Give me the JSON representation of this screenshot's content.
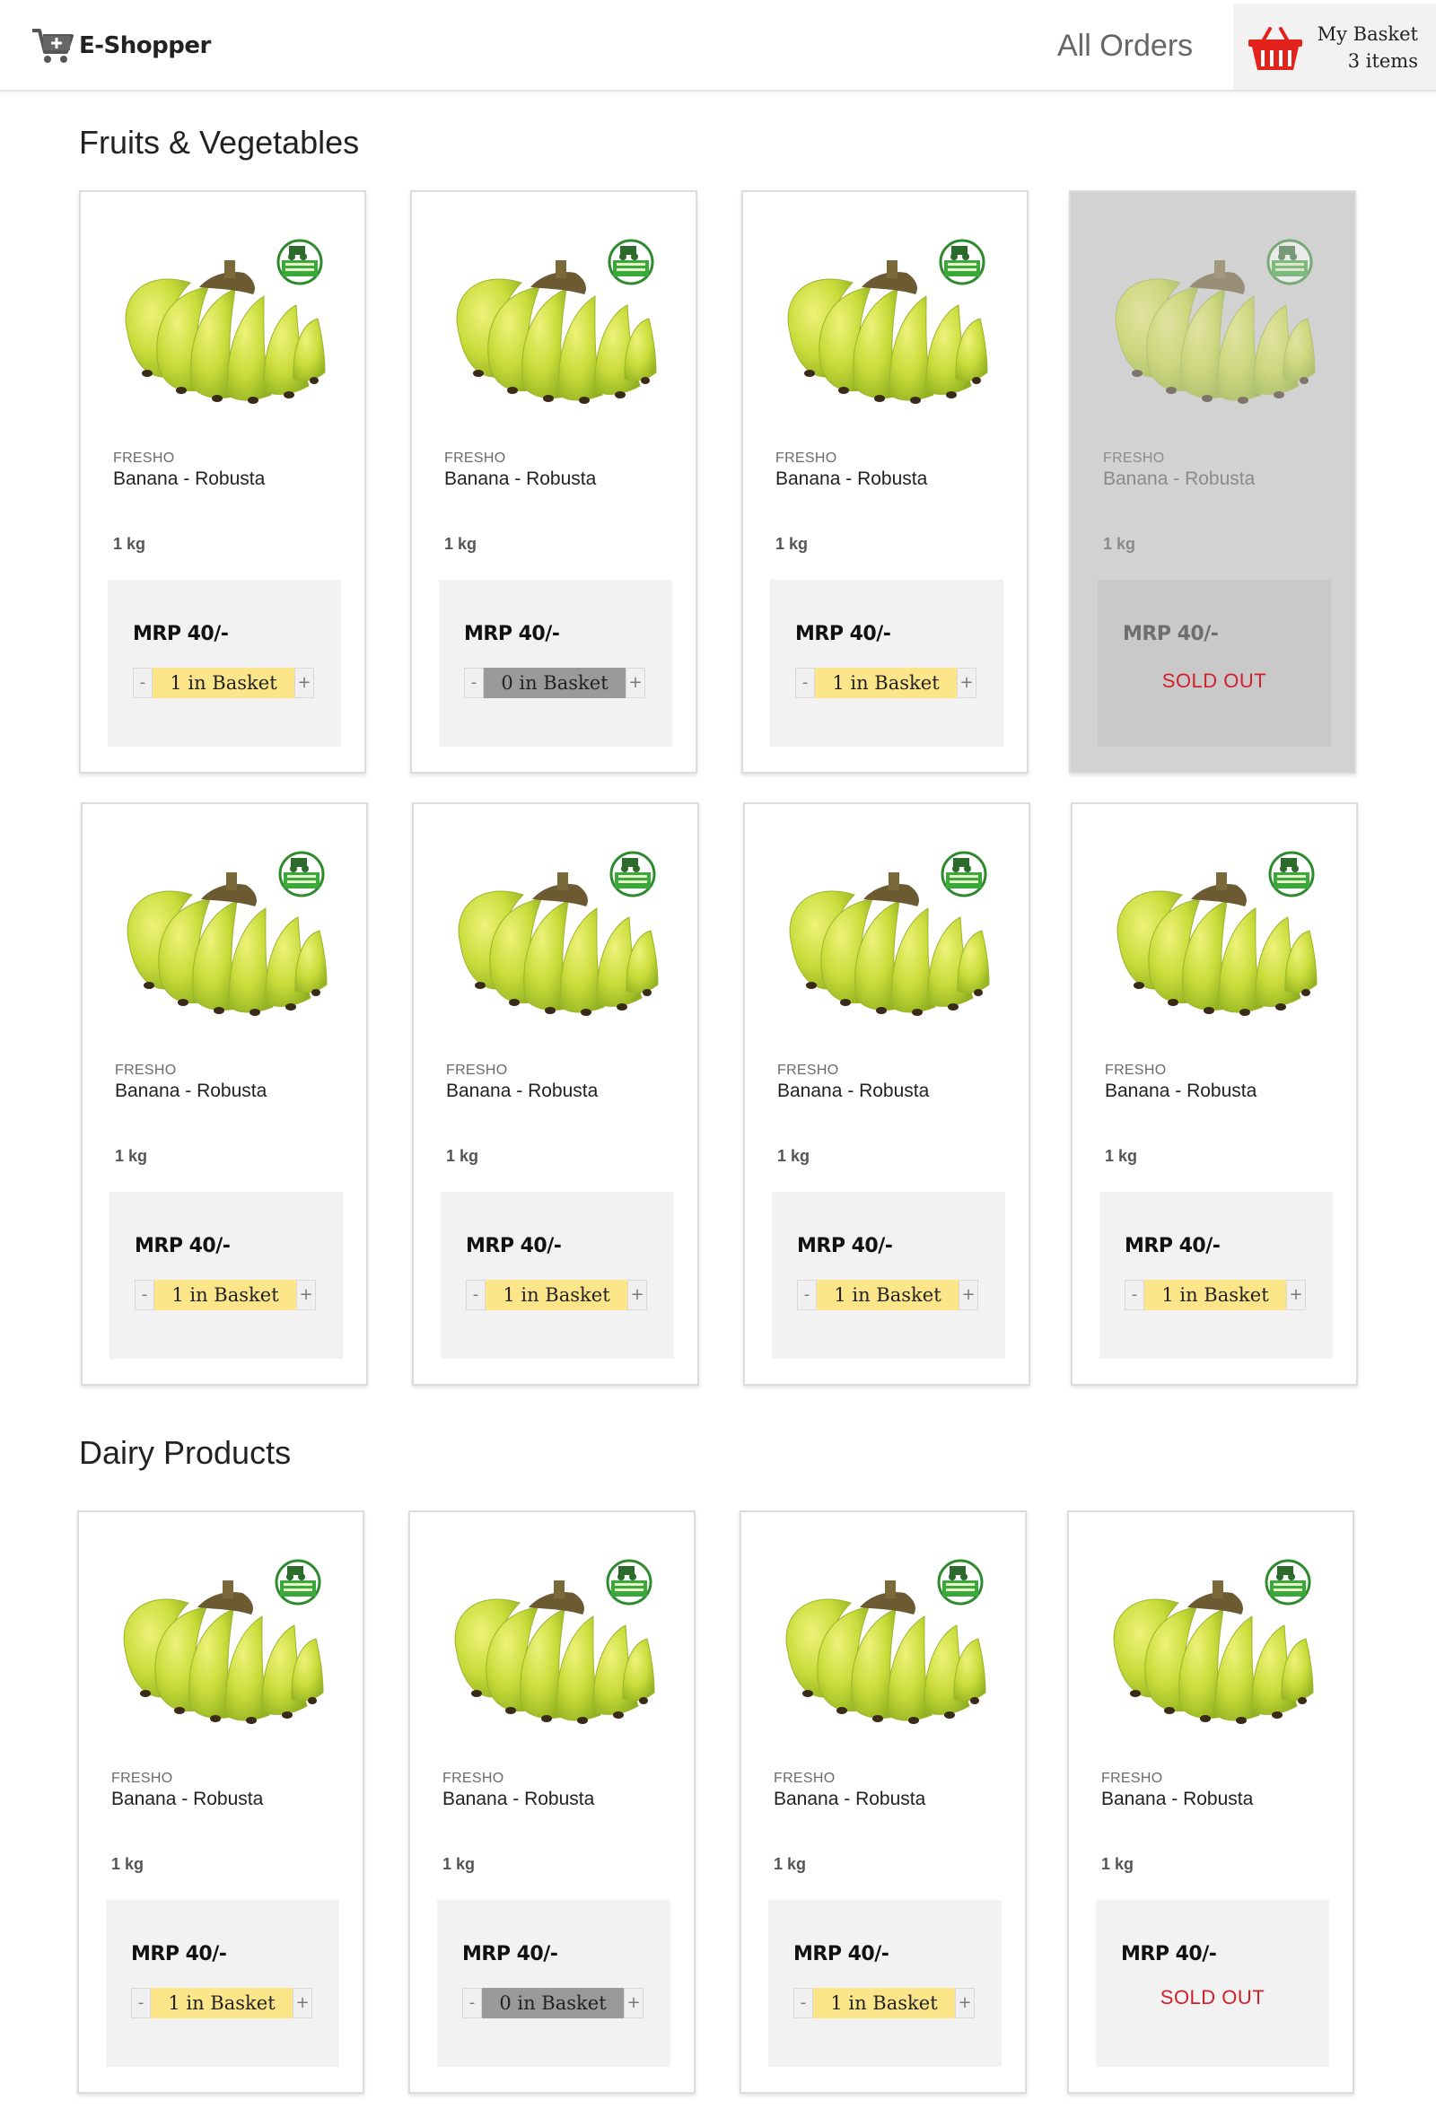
{
  "header": {
    "brand": "E-Shopper",
    "all_orders": "All Orders",
    "basket_title": "My Basket",
    "basket_count": "3 items"
  },
  "colors": {
    "basket_red": "#e3231b",
    "in_basket_yellow": "#fde68a",
    "zero_basket_gray": "#9a9a9a",
    "sold_out_red": "#d1202c"
  },
  "sections": [
    {
      "title": "Fruits & Vegetables",
      "products": [
        {
          "brand": "FRESHO",
          "name": "Banana - Robusta",
          "size": "1 kg",
          "price": "MRP 40/-",
          "basket": "1 in Basket",
          "minus": "-",
          "plus": "+"
        },
        {
          "brand": "FRESHO",
          "name": "Banana - Robusta",
          "size": "1 kg",
          "price": "MRP 40/-",
          "basket": "0 in Basket",
          "minus": "-",
          "plus": "+"
        },
        {
          "brand": "FRESHO",
          "name": "Banana - Robusta",
          "size": "1 kg",
          "price": "MRP 40/-",
          "basket": "1 in Basket",
          "minus": "-",
          "plus": "+"
        },
        {
          "brand": "FRESHO",
          "name": "Banana - Robusta",
          "size": "1 kg",
          "price": "MRP 40/-",
          "status": "SOLD OUT"
        },
        {
          "brand": "FRESHO",
          "name": "Banana - Robusta",
          "size": "1 kg",
          "price": "MRP 40/-",
          "basket": "1 in Basket",
          "minus": "-",
          "plus": "+"
        },
        {
          "brand": "FRESHO",
          "name": "Banana - Robusta",
          "size": "1 kg",
          "price": "MRP 40/-",
          "basket": "1 in Basket",
          "minus": "-",
          "plus": "+"
        },
        {
          "brand": "FRESHO",
          "name": "Banana - Robusta",
          "size": "1 kg",
          "price": "MRP 40/-",
          "basket": "1 in Basket",
          "minus": "-",
          "plus": "+"
        },
        {
          "brand": "FRESHO",
          "name": "Banana - Robusta",
          "size": "1 kg",
          "price": "MRP 40/-",
          "basket": "1 in Basket",
          "minus": "-",
          "plus": "+"
        }
      ]
    },
    {
      "title": "Dairy Products",
      "products": [
        {
          "brand": "FRESHO",
          "name": "Banana - Robusta",
          "size": "1 kg",
          "price": "MRP 40/-",
          "basket": "1 in Basket",
          "minus": "-",
          "plus": "+"
        },
        {
          "brand": "FRESHO",
          "name": "Banana - Robusta",
          "size": "1 kg",
          "price": "MRP 40/-",
          "basket": "0 in Basket",
          "minus": "-",
          "plus": "+"
        },
        {
          "brand": "FRESHO",
          "name": "Banana - Robusta",
          "size": "1 kg",
          "price": "MRP 40/-",
          "basket": "1 in Basket",
          "minus": "-",
          "plus": "+"
        },
        {
          "brand": "FRESHO",
          "name": "Banana - Robusta",
          "size": "1 kg",
          "price": "MRP 40/-",
          "status": "SOLD OUT"
        }
      ]
    }
  ]
}
